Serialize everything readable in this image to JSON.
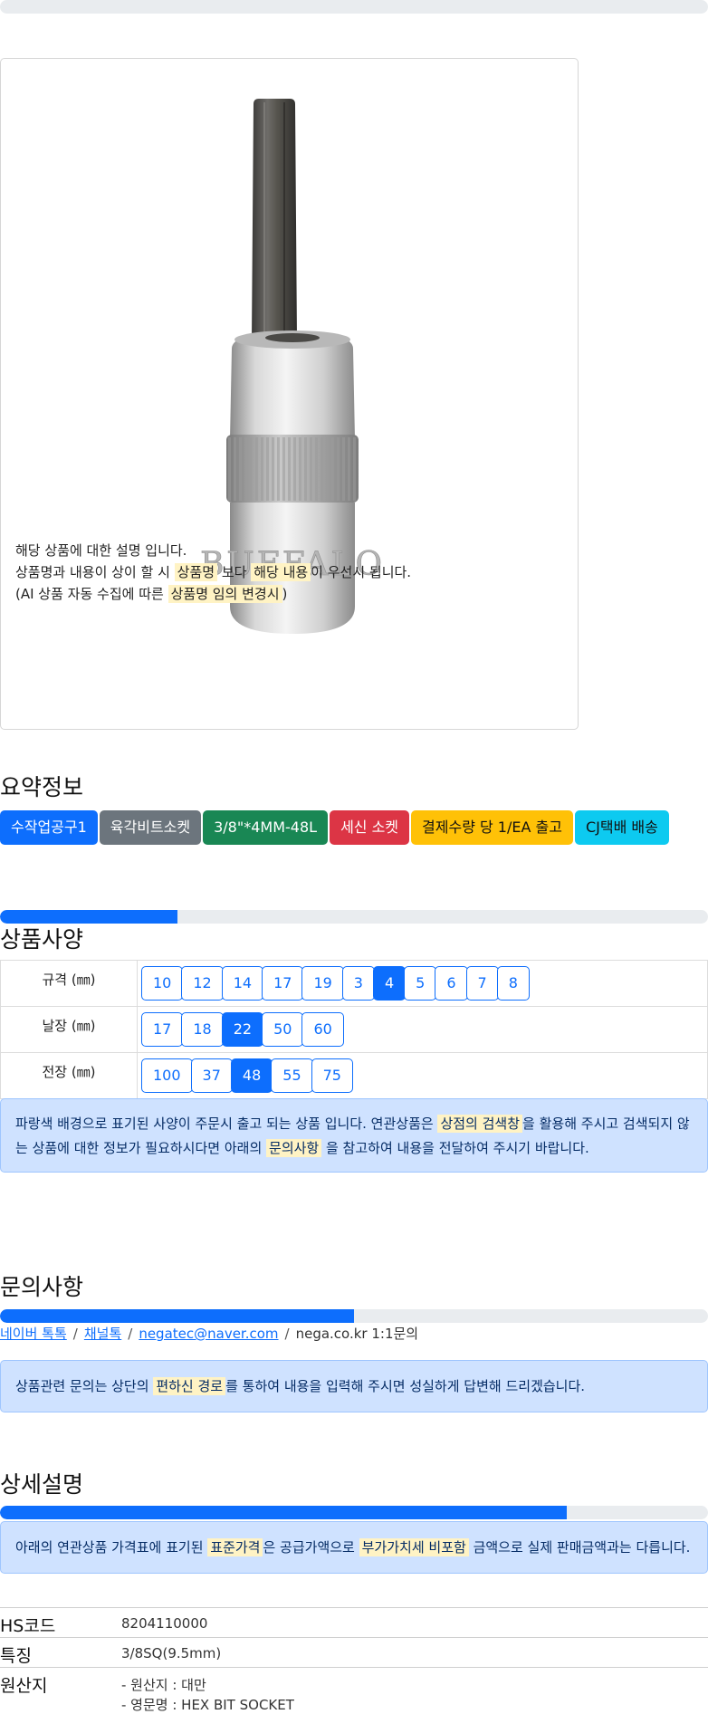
{
  "top_progress": {
    "value": 0
  },
  "product": {
    "brand_text": "BUFFALO",
    "desc_line1": "해당 상품에 대한 설명 입니다.",
    "desc_line2_a": "상품명과 내용이 상이 할 시 ",
    "desc_line2_hl1": "상품명",
    "desc_line2_b": " 보다 ",
    "desc_line2_hl2": "해당 내용",
    "desc_line2_c": "이 우선시 됩니다.",
    "desc_line3_a": "(AI 상품 자동 수집에 따른 ",
    "desc_line3_hl": "상품명 임의 변경시",
    "desc_line3_b": ")"
  },
  "summary": {
    "title": "요약정보",
    "badges": [
      {
        "label": "수작업공구1",
        "color": "#0d6efd"
      },
      {
        "label": "육각비트소켓",
        "color": "#6c757d"
      },
      {
        "label": "3/8\"*4MM-48L",
        "color": "#198754"
      },
      {
        "label": "세신 소켓",
        "color": "#dc3545"
      },
      {
        "label": "결제수량 당 1/EA 출고",
        "color": "#ffc107"
      },
      {
        "label": "CJ택배 배송",
        "color": "#0dcaf0"
      }
    ]
  },
  "spec": {
    "progress": 0.25,
    "title": "상품사양",
    "rows": [
      {
        "label": "규격 (㎜)",
        "options": [
          "10",
          "12",
          "14",
          "17",
          "19",
          "3",
          "4",
          "5",
          "6",
          "7",
          "8"
        ],
        "selected": "4"
      },
      {
        "label": "날장 (㎜)",
        "options": [
          "17",
          "18",
          "22",
          "50",
          "60"
        ],
        "selected": "22"
      },
      {
        "label": "전장 (㎜)",
        "options": [
          "100",
          "37",
          "48",
          "55",
          "75"
        ],
        "selected": "48"
      }
    ],
    "notice_a": "파랑색 배경으로 표기된 사양이 주문시 출고 되는 상품 입니다. 연관상품은 ",
    "notice_hl1": "상점의 검색창",
    "notice_b": "을 활용해 주시고 검색되지 않",
    "notice_c": "는 상품에 대한 정보가 필요하시다면 아래의 ",
    "notice_hl2": "문의사항",
    "notice_d": " 을 참고하여 내용을 전달하여 주시기 바랍니다."
  },
  "inquiry": {
    "title": "문의사항",
    "progress": 0.5,
    "links": [
      "네이버 톡톡",
      "채널톡",
      "negatec@naver.com"
    ],
    "plain": "nega.co.kr 1:1문의",
    "separator": "/",
    "notice_a": "상품관련 문의는 상단의 ",
    "notice_hl": "편하신 경로",
    "notice_b": "를 통하여 내용을 입력해 주시면 성실하게 답변해 드리겠습니다."
  },
  "detail": {
    "title": "상세설명",
    "progress": 0.8,
    "notice_a": "아래의 연관상품 가격표에 표기된 ",
    "notice_hl1": "표준가격",
    "notice_b": "은 공급가액으로 ",
    "notice_hl2": "부가가치세 비포함",
    "notice_c": " 금액으로 실제 판매금액과는 다릅니다.",
    "rows": [
      {
        "key": "HS코드",
        "value": "8204110000"
      },
      {
        "key": "특징",
        "value": "3/8SQ(9.5mm)"
      },
      {
        "key": "원산지",
        "value": "- 원산지 : 대만",
        "value2": "- 영문명 : HEX BIT SOCKET"
      }
    ]
  }
}
